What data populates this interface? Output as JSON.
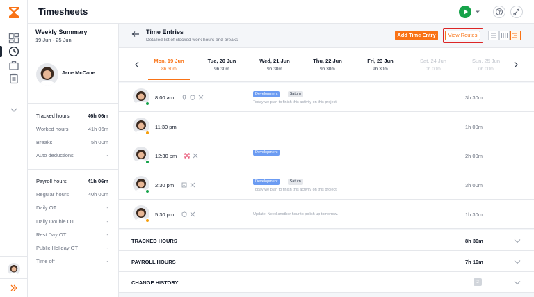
{
  "app": {
    "title": "Timesheets"
  },
  "colors": {
    "accent": "#f97316",
    "tag_dev": "#6b9bf2",
    "online": "#16a34a",
    "away": "#f59e0b",
    "highlight": "#dc2626"
  },
  "rail": {
    "icons": [
      "hourglass-logo-icon",
      "dashboard-icon",
      "clock-icon",
      "briefcase-icon",
      "clipboard-icon",
      "chevron-down-icon",
      "double-chevron-right-icon"
    ]
  },
  "summary": {
    "title": "Weekly Summary",
    "range": "19 Jun - 25 Jun",
    "person": "Jane McCane",
    "tracked_group": [
      {
        "label": "Tracked hours",
        "value": "46h 06m",
        "strong": true
      },
      {
        "label": "Worked hours",
        "value": "41h 06m",
        "strong": false
      },
      {
        "label": "Breaks",
        "value": "5h 00m",
        "strong": false
      },
      {
        "label": "Auto deductions",
        "value": "-",
        "strong": false
      }
    ],
    "payroll_group": [
      {
        "label": "Payroll hours",
        "value": "41h 06m",
        "strong": true
      },
      {
        "label": "Regular hours",
        "value": "40h 00m",
        "strong": false
      },
      {
        "label": "Daily OT",
        "value": "-",
        "strong": false
      },
      {
        "label": "Daily Double OT",
        "value": "-",
        "strong": false
      },
      {
        "label": "Rest Day OT",
        "value": "-",
        "strong": false
      },
      {
        "label": "Public Holiday OT",
        "value": "-",
        "strong": false
      },
      {
        "label": "Time off",
        "value": "-",
        "strong": false
      }
    ]
  },
  "header": {
    "title": "Time Entries",
    "subtitle": "Detailed list of clocked work hours and breaks",
    "add_label": "Add Time Entry",
    "routes_label": "View Routes"
  },
  "days": [
    {
      "name": "Mon, 19 Jun",
      "hours": "8h 30m",
      "state": "active"
    },
    {
      "name": "Tue, 20 Jun",
      "hours": "9h 30m",
      "state": "normal"
    },
    {
      "name": "Wed, 21 Jun",
      "hours": "9h 30m",
      "state": "normal"
    },
    {
      "name": "Thu, 22 Jun",
      "hours": "9h 30m",
      "state": "normal"
    },
    {
      "name": "Fri, 23 Jun",
      "hours": "9h 30m",
      "state": "normal"
    },
    {
      "name": "Sat, 24 Jun",
      "hours": "0h 00m",
      "state": "muted"
    },
    {
      "name": "Sun, 25 Jun",
      "hours": "0h 00m",
      "state": "muted"
    }
  ],
  "entries": [
    {
      "time": "8:00 am",
      "status": "online",
      "icons": [
        "location-pin-icon",
        "shield-icon",
        "scissors-icon"
      ],
      "tags": [
        "Development",
        "Saturn"
      ],
      "note": "Today we plan to finish this activity on this project",
      "duration": "3h 30m"
    },
    {
      "time": "11:30 pm",
      "status": "away",
      "icons": [],
      "tags": [],
      "note": "",
      "duration": "1h 00m"
    },
    {
      "time": "12:30 pm",
      "status": "online",
      "icons": [
        "face-scan-icon",
        "scissors-icon"
      ],
      "tags": [
        "Development"
      ],
      "note": "",
      "duration": "2h 00m"
    },
    {
      "time": "2:30 pm",
      "status": "online",
      "icons": [
        "image-icon",
        "scissors-icon"
      ],
      "tags": [
        "Development",
        "Saturn"
      ],
      "note": "Today we plan to finish this activity on this project",
      "duration": "3h 00m"
    },
    {
      "time": "5:30 pm",
      "status": "away",
      "icons": [
        "shield-icon",
        "scissors-icon"
      ],
      "tags": [],
      "note": "Update: Need another hour to polish up tomorrow.",
      "duration": "1h 30m"
    }
  ],
  "sections": [
    {
      "title": "TRACKED HOURS",
      "value": "8h 30m",
      "badge": ""
    },
    {
      "title": "PAYROLL HOURS",
      "value": "7h 19m",
      "badge": ""
    },
    {
      "title": "CHANGE HISTORY",
      "value": "",
      "badge": "2"
    }
  ]
}
